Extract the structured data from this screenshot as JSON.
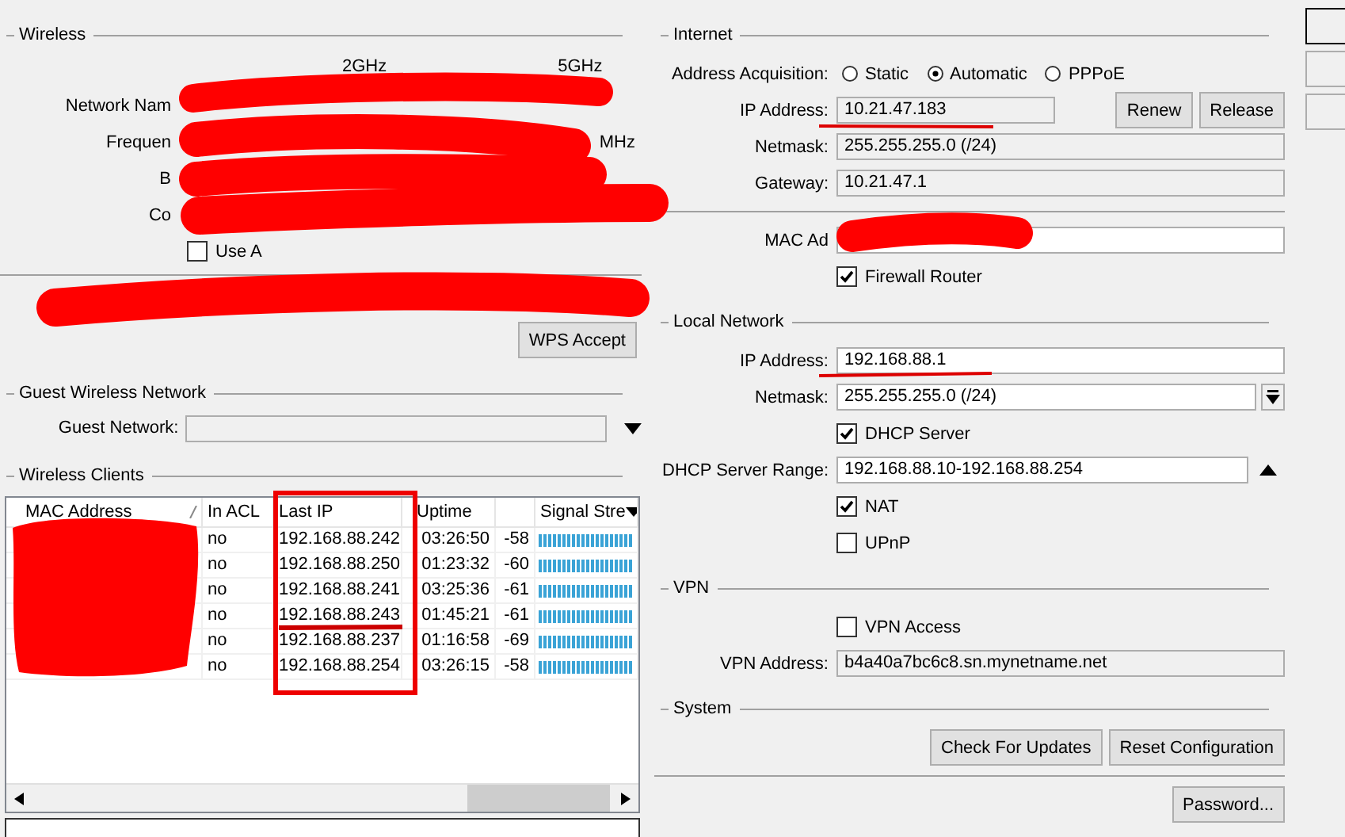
{
  "wireless": {
    "title": "Wireless",
    "bands": [
      "2GHz",
      "5GHz"
    ],
    "fields": [
      {
        "label": "Network Nam"
      },
      {
        "label": "Frequen",
        "unit": "MHz"
      },
      {
        "label": "B"
      },
      {
        "label": "Co"
      }
    ],
    "checkbox": {
      "label": "Use A",
      "checked": false
    },
    "wps_button": "WPS Accept"
  },
  "guest": {
    "title": "Guest Wireless Network",
    "label": "Guest Network:"
  },
  "clients": {
    "title": "Wireless Clients",
    "columns": [
      "MAC Address",
      "In ACL",
      "Last IP",
      "Uptime",
      "Signal Stre"
    ],
    "rows": [
      {
        "in_acl": "no",
        "last_ip": "192.168.88.242",
        "uptime": "03:26:50",
        "signal": "-58"
      },
      {
        "in_acl": "no",
        "last_ip": "192.168.88.250",
        "uptime": "01:23:32",
        "signal": "-60"
      },
      {
        "in_acl": "no",
        "last_ip": "192.168.88.241",
        "uptime": "03:25:36",
        "signal": "-61"
      },
      {
        "in_acl": "no",
        "last_ip": "192.168.88.243",
        "uptime": "01:45:21",
        "signal": "-61"
      },
      {
        "in_acl": "no",
        "last_ip": "192.168.88.237",
        "uptime": "01:16:58",
        "signal": "-69"
      },
      {
        "in_acl": "no",
        "last_ip": "192.168.88.254",
        "uptime": "03:26:15",
        "signal": "-58"
      }
    ]
  },
  "sections": [
    {
      "title": "Internet",
      "items": [
        {
          "kind": "radios",
          "label": "Address Acquisition:",
          "options": [
            {
              "label": "Static",
              "selected": false
            },
            {
              "label": "Automatic",
              "selected": true
            },
            {
              "label": "PPPoE",
              "selected": false
            }
          ]
        },
        {
          "kind": "field",
          "label": "IP Address:",
          "value": "10.21.47.183",
          "readonly": true,
          "buttons": [
            "Renew",
            "Release"
          ]
        },
        {
          "kind": "field",
          "label": "Netmask:",
          "value": "255.255.255.0 (/24)",
          "readonly": true
        },
        {
          "kind": "field",
          "label": "Gateway:",
          "value": "10.21.47.1",
          "readonly": true
        },
        {
          "kind": "divider"
        },
        {
          "kind": "field",
          "label": "MAC Ad",
          "readonly": false
        },
        {
          "kind": "checkbox",
          "label": "Firewall Router",
          "checked": true
        }
      ]
    },
    {
      "title": "Local Network",
      "items": [
        {
          "kind": "field",
          "label": "IP Address:",
          "value": "192.168.88.1",
          "readonly": false
        },
        {
          "kind": "field",
          "label": "Netmask:",
          "value": "255.255.255.0 (/24)",
          "readonly": false,
          "dropdown": true
        },
        {
          "kind": "checkbox",
          "label": "DHCP Server",
          "checked": true
        },
        {
          "kind": "field",
          "label": "DHCP Server Range:",
          "value": "192.168.88.10-192.168.88.254",
          "readonly": false,
          "expanded": true
        },
        {
          "kind": "checkbox",
          "label": "NAT",
          "checked": true
        },
        {
          "kind": "checkbox",
          "label": "UPnP",
          "checked": false
        }
      ]
    },
    {
      "title": "VPN",
      "items": [
        {
          "kind": "checkbox",
          "label": "VPN Access",
          "checked": false
        },
        {
          "kind": "field",
          "label": "VPN Address:",
          "value": "b4a40a7bc6c8.sn.mynetname.net",
          "readonly": true
        }
      ]
    },
    {
      "title": "System",
      "items": [
        {
          "kind": "buttons",
          "buttons": [
            "Check For Updates",
            "Reset Configuration"
          ]
        },
        {
          "kind": "divider"
        },
        {
          "kind": "buttons",
          "buttons": [
            "Password..."
          ]
        }
      ]
    }
  ]
}
